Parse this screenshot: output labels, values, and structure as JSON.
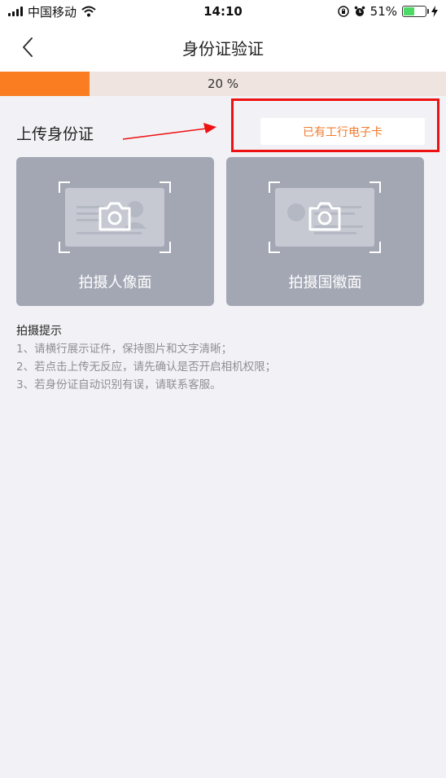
{
  "status_bar": {
    "carrier": "中国移动",
    "time": "14:10",
    "battery_text": "51%",
    "battery_level": 0.51
  },
  "nav": {
    "title": "身份证验证",
    "back_icon": "chevron-left-icon"
  },
  "progress": {
    "value": 0.2,
    "label": "20 %",
    "fill_color": "#fa7d22",
    "track_color": "#efe4df"
  },
  "upload": {
    "section_title": "上传身份证",
    "ecard_button_label": "已有工行电子卡",
    "highlight_color": "#ee1111",
    "front_card_label": "拍摄人像面",
    "back_card_label": "拍摄国徽面"
  },
  "tips": {
    "title": "拍摄提示",
    "lines": [
      "1、请横行展示证件，保持图片和文字清晰；",
      "2、若点击上传无反应，请先确认是否开启相机权限；",
      "3、若身份证自动识别有误，请联系客服。"
    ]
  },
  "colors": {
    "accent": "#fa7d22",
    "card_bg": "#a3a7b4",
    "page_bg": "#f2f2f6"
  }
}
